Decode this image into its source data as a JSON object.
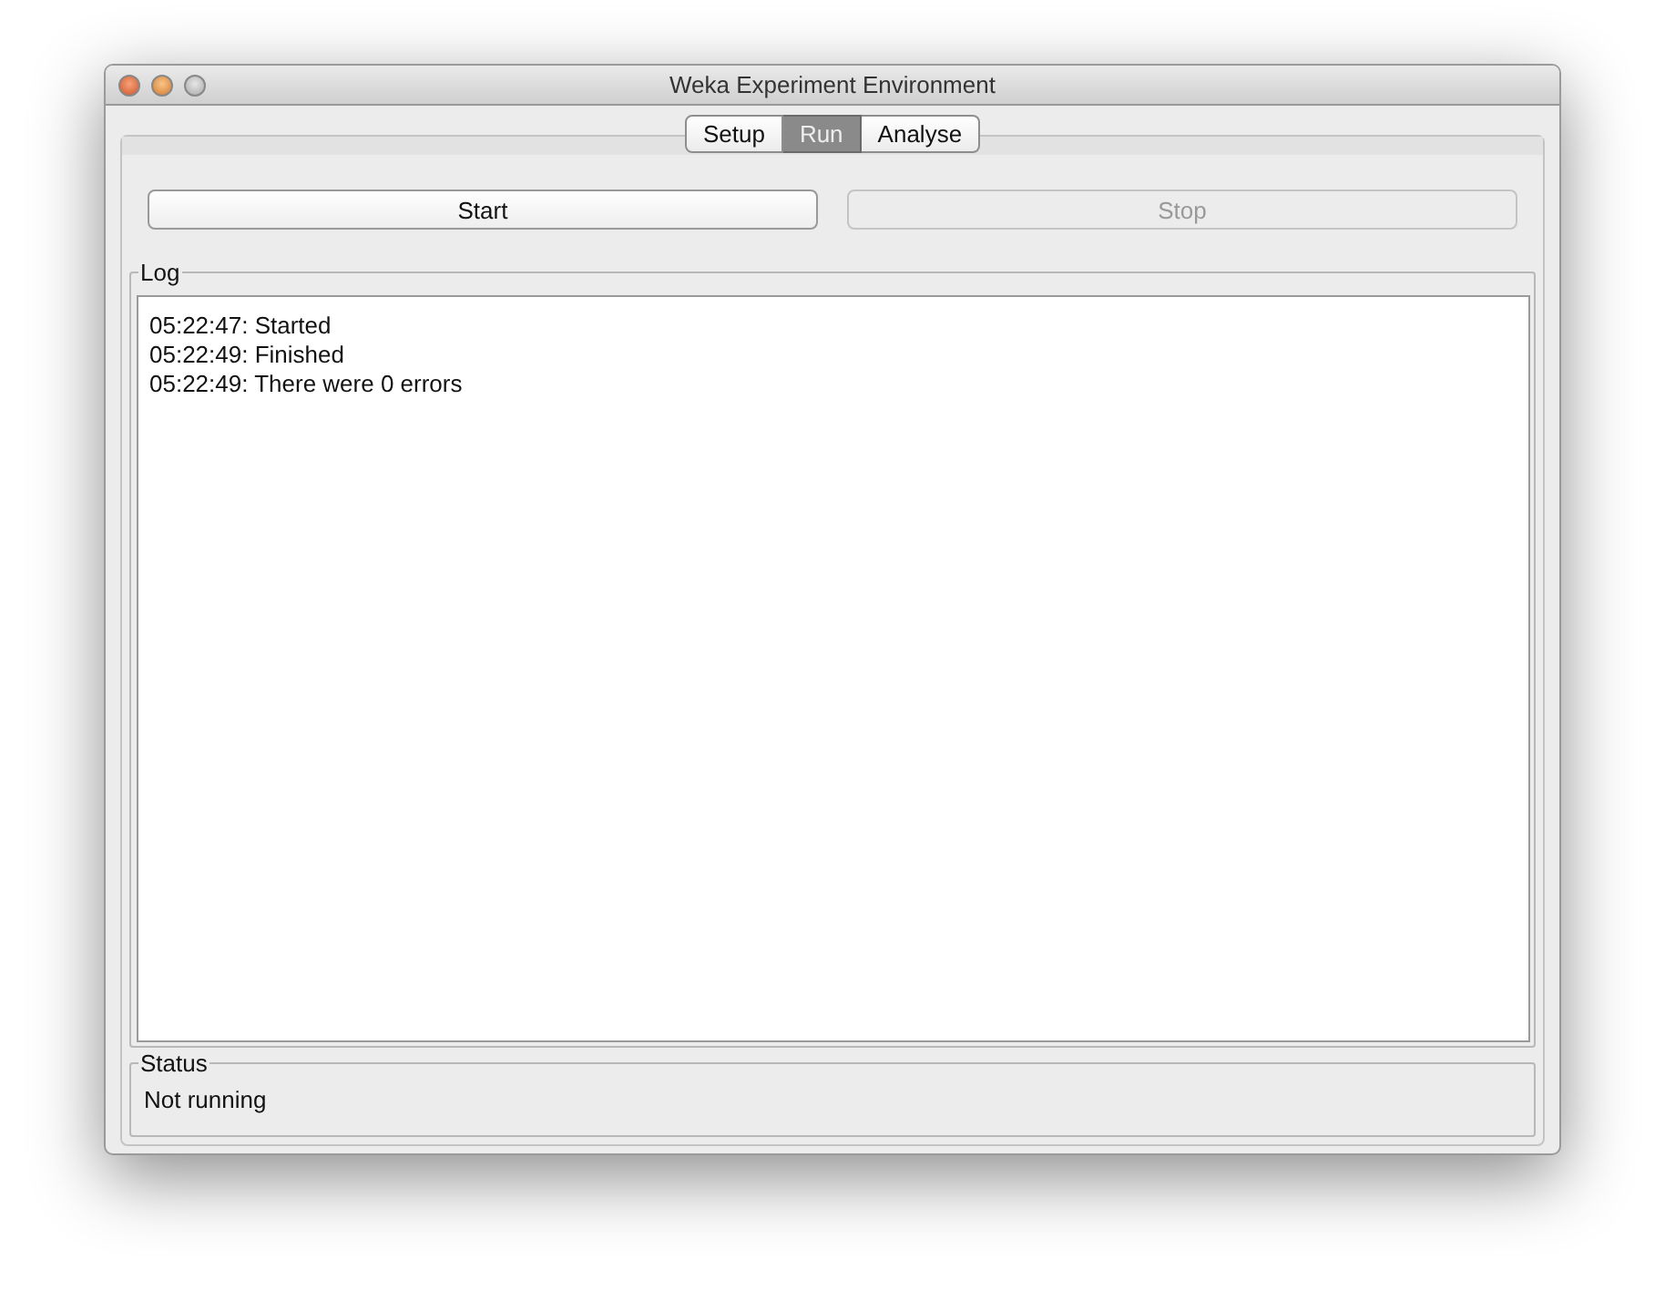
{
  "window": {
    "title": "Weka Experiment Environment"
  },
  "tabs": [
    {
      "label": "Setup",
      "selected": false
    },
    {
      "label": "Run",
      "selected": true
    },
    {
      "label": "Analyse",
      "selected": false
    }
  ],
  "buttons": [
    {
      "label": "Start",
      "disabled": false
    },
    {
      "label": "Stop",
      "disabled": true
    }
  ],
  "log": {
    "title": "Log",
    "lines": [
      "05:22:47: Started",
      "05:22:49: Finished",
      "05:22:49: There were 0 errors"
    ]
  },
  "status": {
    "title": "Status",
    "text": "Not running"
  }
}
